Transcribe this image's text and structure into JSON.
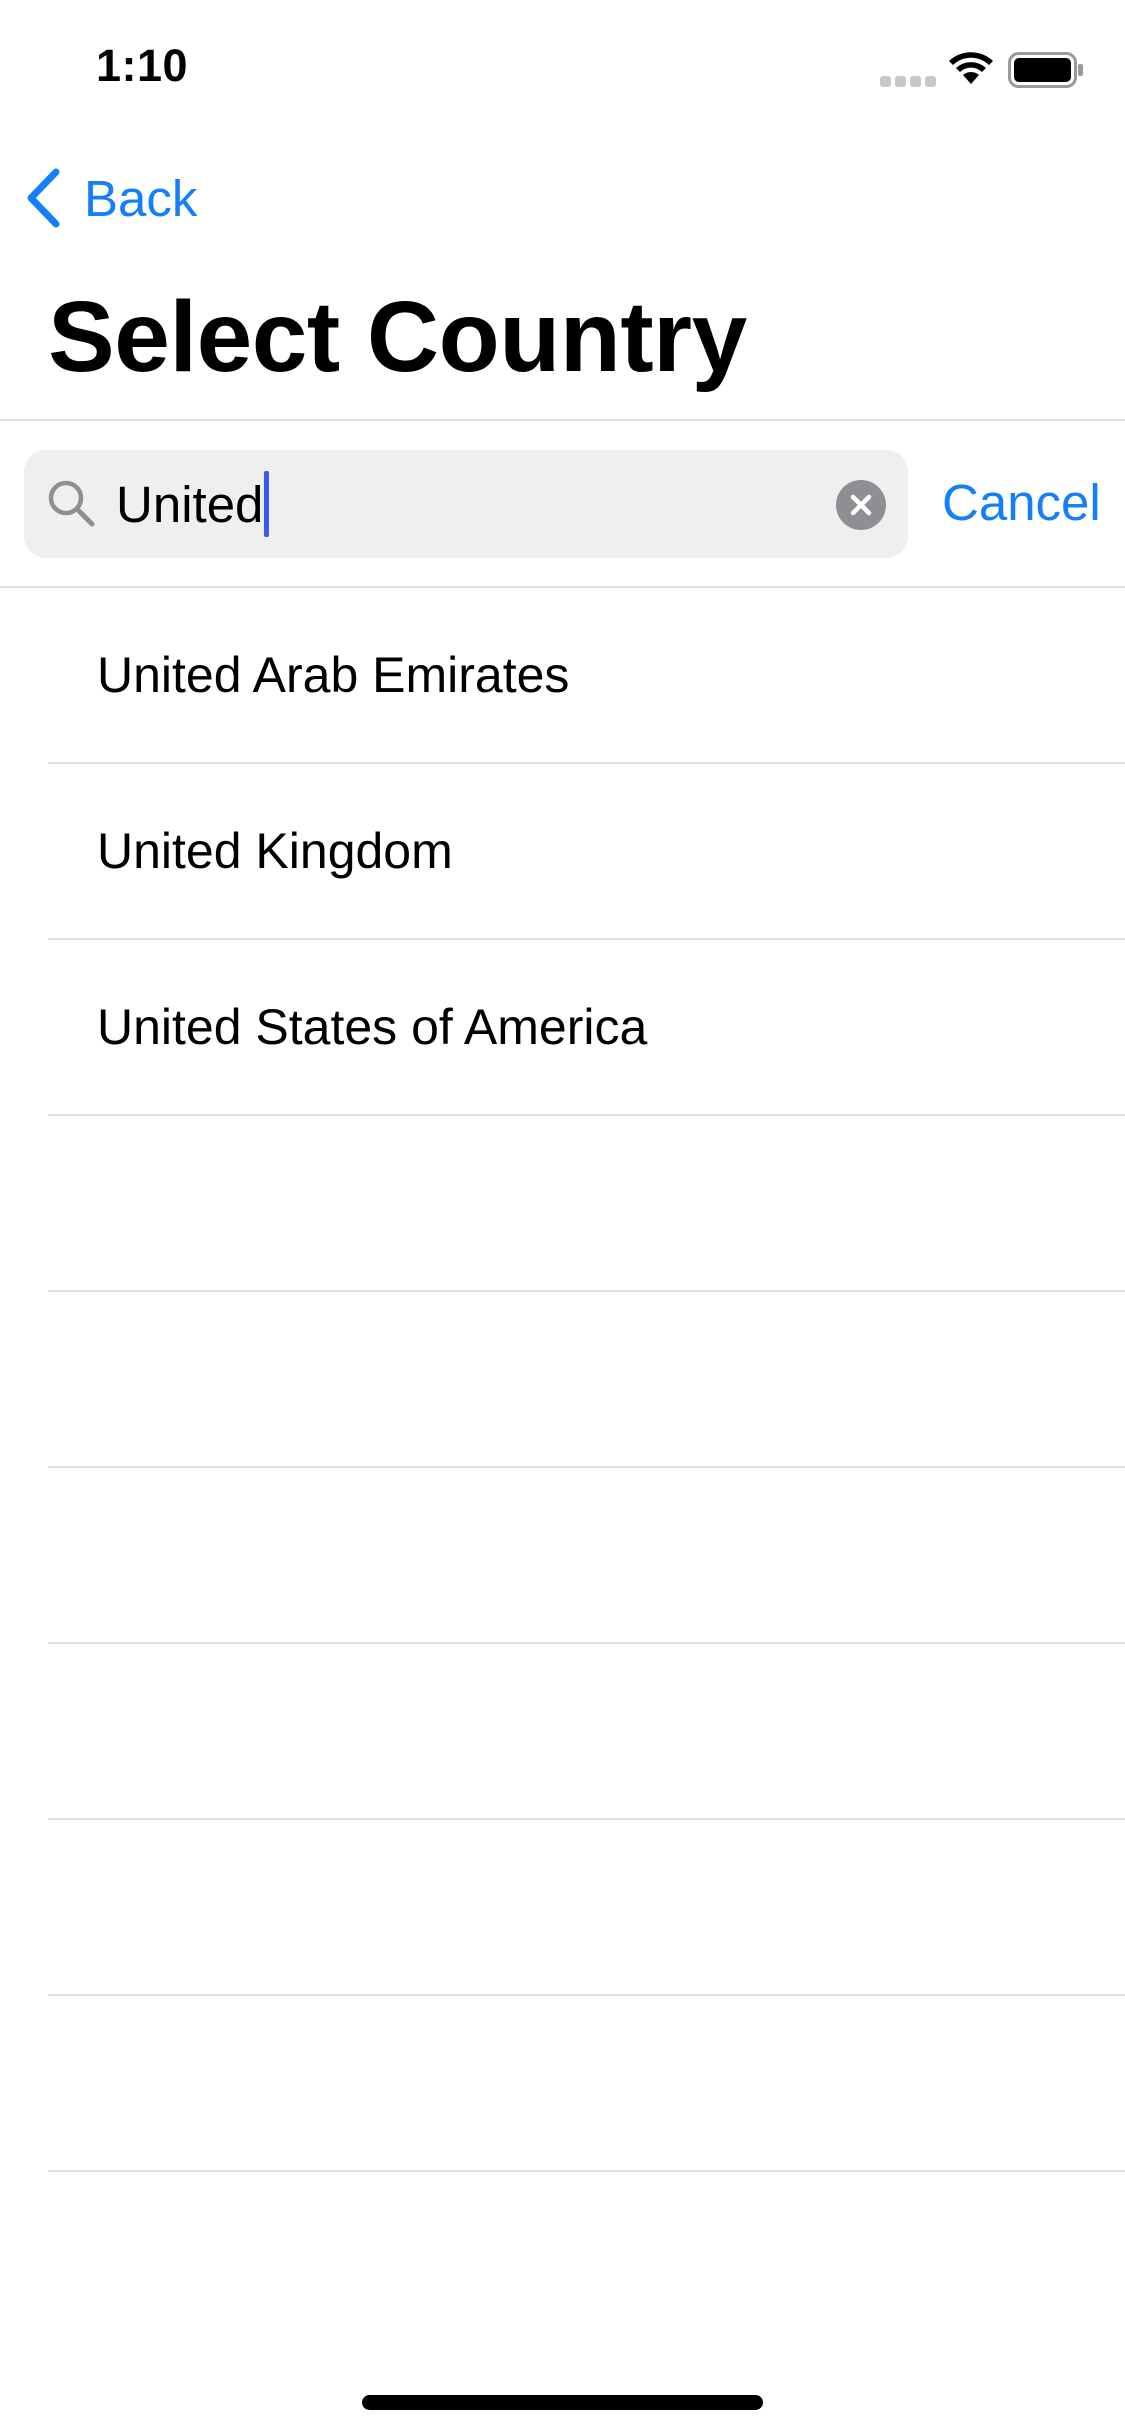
{
  "status_bar": {
    "time": "1:10",
    "icons": [
      "cellular-signal-icon",
      "wifi-icon",
      "battery-icon"
    ]
  },
  "nav": {
    "back_label": "Back",
    "title": "Select Country"
  },
  "search": {
    "value": "United",
    "placeholder": "",
    "cancel_label": "Cancel"
  },
  "results": [
    {
      "label": "United Arab Emirates"
    },
    {
      "label": "United Kingdom"
    },
    {
      "label": "United States of America"
    },
    {
      "label": ""
    },
    {
      "label": ""
    },
    {
      "label": ""
    },
    {
      "label": ""
    },
    {
      "label": ""
    },
    {
      "label": ""
    }
  ],
  "colors": {
    "accent": "#157efb",
    "cursor": "#3a59f0",
    "search_background": "#efeff0",
    "separator": "#e0e0e3",
    "clear_button": "#8e8e93"
  }
}
